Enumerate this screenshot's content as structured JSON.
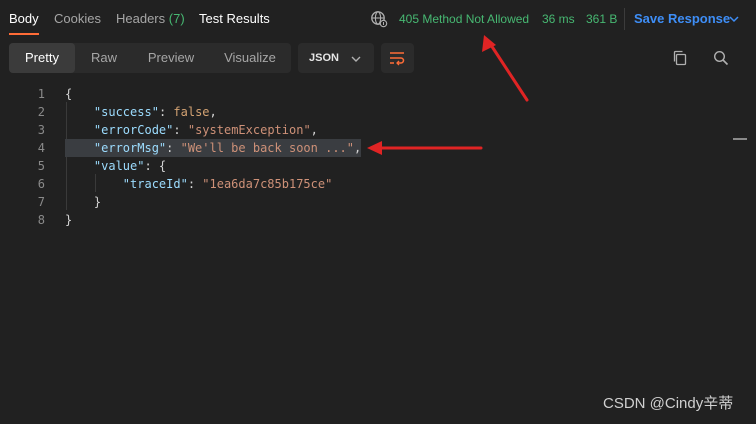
{
  "tabs": {
    "body": "Body",
    "cookies": "Cookies",
    "headers": "Headers",
    "headers_count": "(7)",
    "test_results": "Test Results"
  },
  "response": {
    "status": "405 Method Not Allowed",
    "time": "36 ms",
    "size": "361 B",
    "save_label": "Save Response"
  },
  "toolbar": {
    "views": [
      "Pretty",
      "Raw",
      "Preview",
      "Visualize"
    ],
    "active_view": "Pretty",
    "format": "JSON"
  },
  "code": {
    "line_numbers": [
      "1",
      "2",
      "3",
      "4",
      "5",
      "6",
      "7",
      "8"
    ],
    "highlighted_line": 4,
    "lines": [
      [
        {
          "t": "{",
          "c": "punct"
        }
      ],
      [
        {
          "t": "    ",
          "c": "punct"
        },
        {
          "t": "\"success\"",
          "c": "key"
        },
        {
          "t": ": ",
          "c": "punct"
        },
        {
          "t": "false",
          "c": "kw"
        },
        {
          "t": ",",
          "c": "punct"
        }
      ],
      [
        {
          "t": "    ",
          "c": "punct"
        },
        {
          "t": "\"errorCode\"",
          "c": "key"
        },
        {
          "t": ": ",
          "c": "punct"
        },
        {
          "t": "\"systemException\"",
          "c": "str"
        },
        {
          "t": ",",
          "c": "punct"
        }
      ],
      [
        {
          "t": "    ",
          "c": "punct"
        },
        {
          "t": "\"errorMsg\"",
          "c": "key"
        },
        {
          "t": ": ",
          "c": "punct"
        },
        {
          "t": "\"We'll be back soon ...\"",
          "c": "str"
        },
        {
          "t": ",",
          "c": "punct"
        }
      ],
      [
        {
          "t": "    ",
          "c": "punct"
        },
        {
          "t": "\"value\"",
          "c": "key"
        },
        {
          "t": ": {",
          "c": "punct"
        }
      ],
      [
        {
          "t": "        ",
          "c": "punct"
        },
        {
          "t": "\"traceId\"",
          "c": "key"
        },
        {
          "t": ": ",
          "c": "punct"
        },
        {
          "t": "\"1ea6da7c85b175ce\"",
          "c": "str"
        }
      ],
      [
        {
          "t": "    }",
          "c": "punct"
        }
      ],
      [
        {
          "t": "}",
          "c": "punct"
        }
      ]
    ]
  },
  "watermark": "CSDN @Cindy辛蒂",
  "colors": {
    "status_green": "#47b872",
    "accent_blue": "#3e8ef7",
    "annotation_red": "#e02424",
    "background": "#212121"
  }
}
